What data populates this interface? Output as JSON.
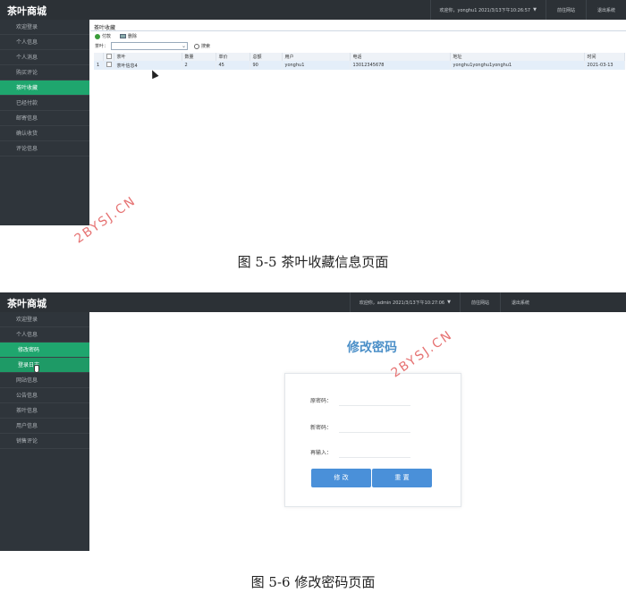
{
  "shot1": {
    "brand": "茶叶商城",
    "welcome": "欢迎你，yonghu1 2021/3/13下午10:26:57",
    "nav_buttons": [
      "前往网站",
      "退出系统"
    ],
    "sidebar": [
      "欢迎登录",
      "个人信息",
      "个人消息",
      "购买评论",
      "茶叶收藏",
      "已经付款",
      "邮寄信息",
      "确认收货",
      "评论信息"
    ],
    "active_index": 4,
    "panel_title": "茶叶收藏",
    "toolbar": {
      "add": "付款",
      "delete": "删除"
    },
    "search": {
      "label": "茶叶：",
      "button": "搜索"
    },
    "table": {
      "headers": [
        "",
        "",
        "茶叶",
        "数量",
        "单价",
        "总额",
        "用户",
        "电话",
        "地址",
        "时间"
      ],
      "rows": [
        [
          "1",
          "",
          "茶叶信息4",
          "2",
          "45",
          "90",
          "yonghu1",
          "13012345678",
          "yonghu1yonghu1yonghu1",
          "2021-03-13"
        ]
      ]
    }
  },
  "caption1": "图 5-5 茶叶收藏信息页面",
  "watermark": "2BYSJ.CN",
  "shot2": {
    "brand": "茶叶商城",
    "welcome": "欢迎你，admin 2021/3/13下午10:27:06",
    "nav_buttons": [
      "前往网站",
      "退出系统"
    ],
    "sidebar": [
      "欢迎登录",
      "个人信息",
      "修改密码",
      "登录日志",
      "网站信息",
      "公告信息",
      "茶叶信息",
      "用户信息",
      "销售评论"
    ],
    "active_group": [
      1,
      2,
      3
    ],
    "form": {
      "title": "修改密码",
      "old_label": "原密码：",
      "new_label": "新密码：",
      "confirm_label": "再输入：",
      "submit": "修 改",
      "reset": "重 置"
    }
  },
  "caption2": "图 5-6 修改密码页面",
  "colors": {
    "topbar": "#2c3136",
    "sidebar": "#2f353b",
    "active": "#1fa66e",
    "primary_button": "#4a90d9"
  }
}
